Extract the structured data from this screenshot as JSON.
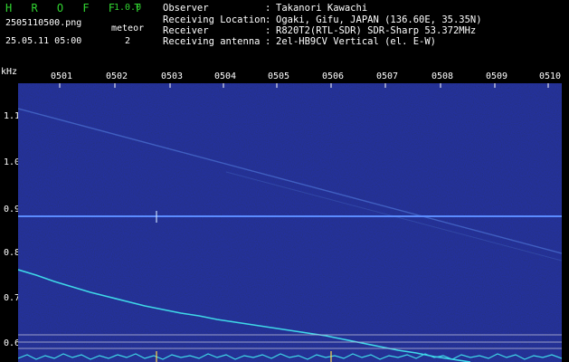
{
  "app": {
    "title": "H R O F F T",
    "version": "1.0.0",
    "file_name": "2505110500.png",
    "date_time": "25.05.11 05:00",
    "meteor_label": "meteor",
    "meteor_count": "2"
  },
  "info": [
    {
      "label": "Observer",
      "value": "Takanori Kawachi"
    },
    {
      "label": "Receiving Location",
      "value": "Ogaki, Gifu, JAPAN (136.60E, 35.35N)"
    },
    {
      "label": "Receiver",
      "value": "R820T2(RTL-SDR) SDR-Sharp 53.372MHz"
    },
    {
      "label": "Receiving antenna",
      "value": "2el-HB9CV Vertical (el. E-W)"
    }
  ],
  "info_colon": ":",
  "axes": {
    "unit": "kHz",
    "time_labels": [
      "0501",
      "0502",
      "0503",
      "0504",
      "0505",
      "0506",
      "0507",
      "0508",
      "0509",
      "0510"
    ],
    "freq_labels": [
      "1.1",
      "1.0",
      "0.9",
      "0.8",
      "0.7",
      "0.6"
    ]
  },
  "colors": {
    "background": "#000000",
    "plot_background": "#0a0a4a",
    "title_green": "#31d431",
    "signal_cyan": "#3fd8e8",
    "carrier_blue": "#5b8cff"
  }
}
